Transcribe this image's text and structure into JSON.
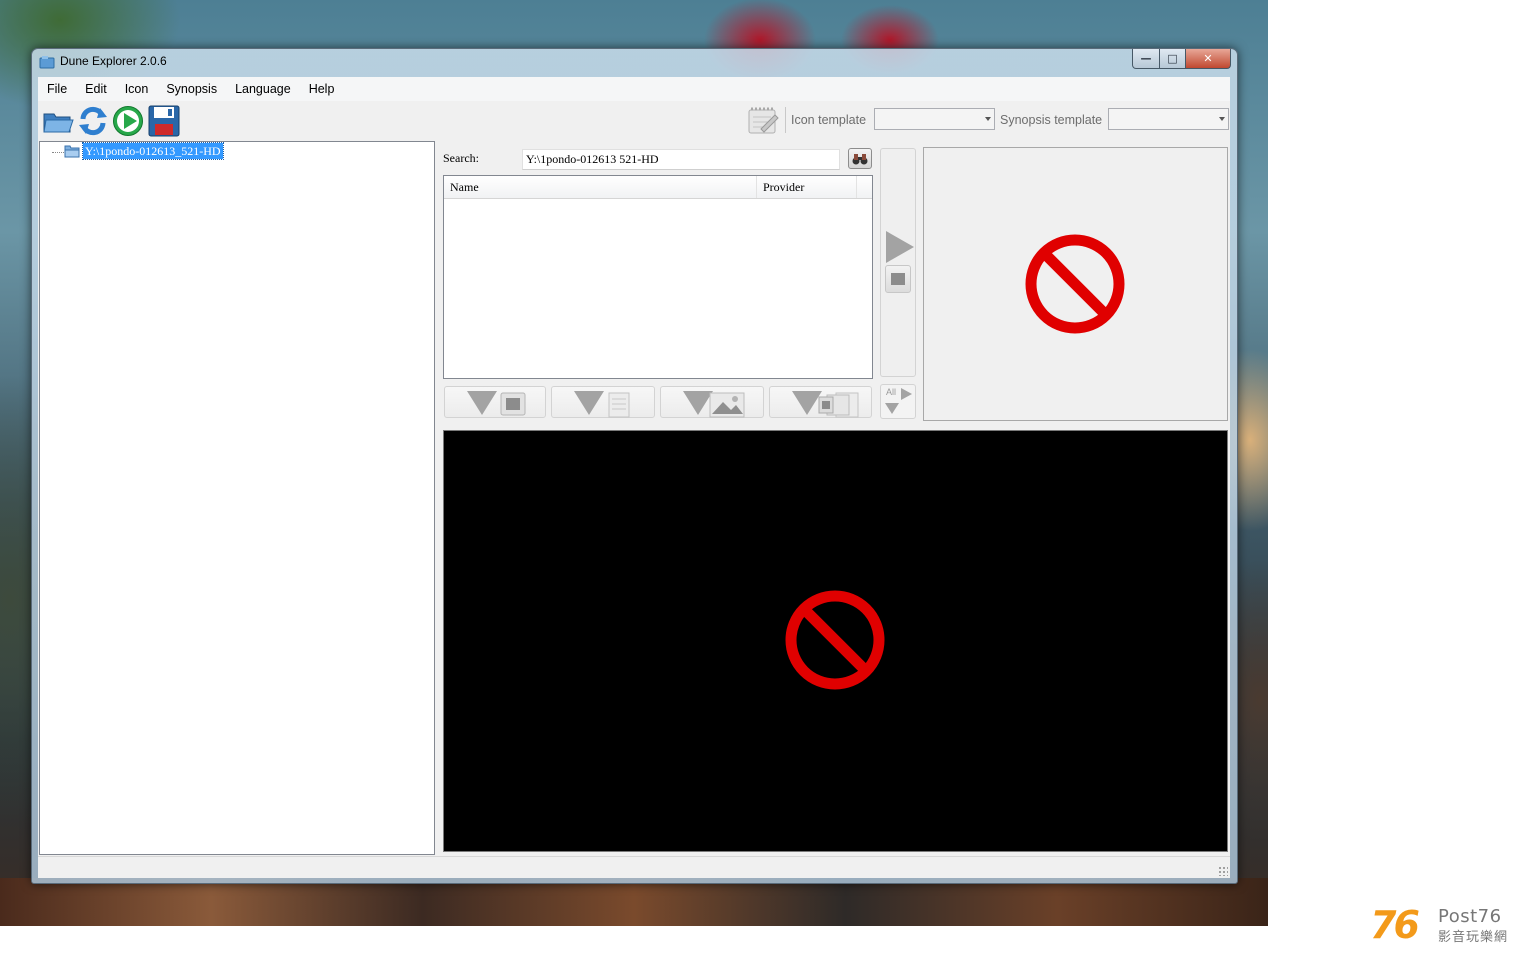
{
  "window": {
    "title": "Dune Explorer 2.0.6"
  },
  "menu": [
    "File",
    "Edit",
    "Icon",
    "Synopsis",
    "Language",
    "Help"
  ],
  "toolbar": {
    "icon_template_label": "Icon template",
    "icon_template_value": "",
    "synopsis_template_label": "Synopsis template",
    "synopsis_template_value": ""
  },
  "tree": {
    "root_label": "Y:\\1pondo-012613_521-HD"
  },
  "search": {
    "label": "Search:",
    "value": "Y:\\1pondo-012613 521-HD"
  },
  "results": {
    "columns": [
      "Name",
      "Provider"
    ],
    "rows": []
  },
  "side": {
    "all_label": "All"
  },
  "watermark": {
    "number": "76",
    "brand": "Post76",
    "tagline": "影音玩樂網"
  },
  "colors": {
    "selection": "#3399ff",
    "no_icon_red": "#e00000",
    "preview_background": "#000000"
  }
}
